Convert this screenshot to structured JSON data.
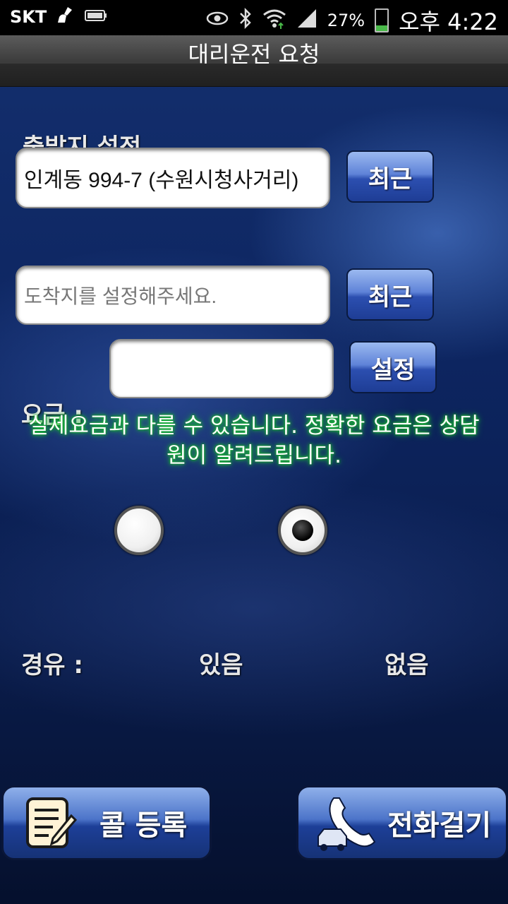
{
  "status_bar": {
    "carrier": "SKT",
    "battery_percent": "27%",
    "battery_level": 0.27,
    "time": "오후 4:22"
  },
  "titlebar": {
    "title": "대리운전 요청"
  },
  "departure": {
    "label": "출발지 설정",
    "value": "인계동 994-7 (수원시청사거리)",
    "recent_button": "최근"
  },
  "destination": {
    "placeholder": "도착지를 설정해주세요.",
    "recent_button": "최근"
  },
  "waypoint_input": {
    "value": "",
    "set_button": "설정"
  },
  "fare": {
    "label": "요금 :",
    "notice": "실제요금과 다를 수 있습니다. 정확한 요금은 상담원이 알려드립니다."
  },
  "via": {
    "label": "경유 :",
    "options": [
      {
        "label": "있음",
        "selected": false
      },
      {
        "label": "없음",
        "selected": true
      }
    ]
  },
  "bottom": {
    "register_call": "콜 등록",
    "make_call": "전화걸기"
  }
}
